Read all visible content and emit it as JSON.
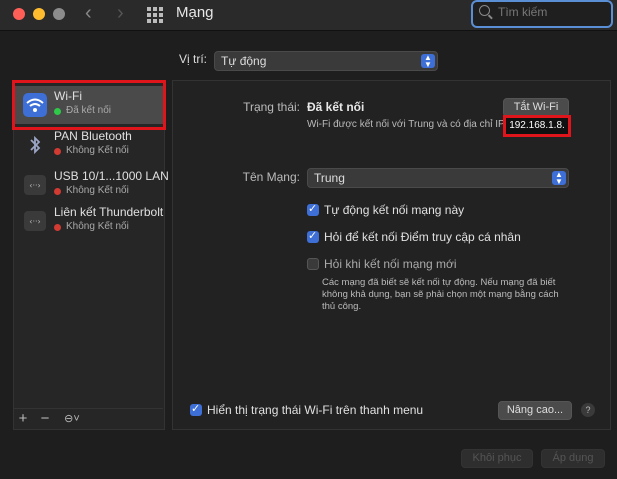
{
  "window": {
    "title": "Mạng",
    "search_placeholder": "Tìm kiếm"
  },
  "location": {
    "label": "Vị trí:",
    "value": "Tự động"
  },
  "sidebar": {
    "items": [
      {
        "name": "Wi-Fi",
        "status": "Đã kết nối",
        "status_color": "#2fc94a",
        "icon": "wifi-icon"
      },
      {
        "name": "PAN Bluetooth",
        "status": "Không Kết nối",
        "status_color": "#d23b32",
        "icon": "bluetooth-icon"
      },
      {
        "name": "USB 10/1...1000 LAN",
        "status": "Không Kết nối",
        "status_color": "#d23b32",
        "icon": "ethernet-icon"
      },
      {
        "name": "Liên kết Thunderbolt",
        "status": "Không Kết nối",
        "status_color": "#d23b32",
        "icon": "ethernet-icon"
      }
    ],
    "add_label": "+",
    "remove_label": "−",
    "action_label": "⊖˅"
  },
  "status": {
    "label": "Trạng thái:",
    "value": "Đã kết nối",
    "turn_off_button": "Tắt Wi-Fi",
    "description": "Wi-Fi được kết nối với Trung và có địa chỉ IP",
    "ip": "192.168.1.8."
  },
  "network_name": {
    "label": "Tên Mạng:",
    "value": "Trung"
  },
  "checkboxes": [
    {
      "label": "Tự động kết nối mạng này",
      "checked": true
    },
    {
      "label": "Hỏi để kết nối Điểm truy cập cá nhân",
      "checked": true
    },
    {
      "label": "Hỏi khi kết nối mạng mới",
      "checked": false
    }
  ],
  "ask_description": "Các mạng đã biết sẽ kết nối tự động. Nếu mạng đã biết không khả dụng, bạn sẽ phải chọn một mạng bằng cách thủ công.",
  "show_status": {
    "label": "Hiển thị trạng thái Wi-Fi trên thanh menu",
    "checked": true
  },
  "advanced_button": "Nâng cao...",
  "help_label": "?",
  "revert_button": "Khôi phục",
  "apply_button": "Áp dụng",
  "colors": {
    "accent": "#3d6fd6",
    "highlight": "#e0141b"
  }
}
